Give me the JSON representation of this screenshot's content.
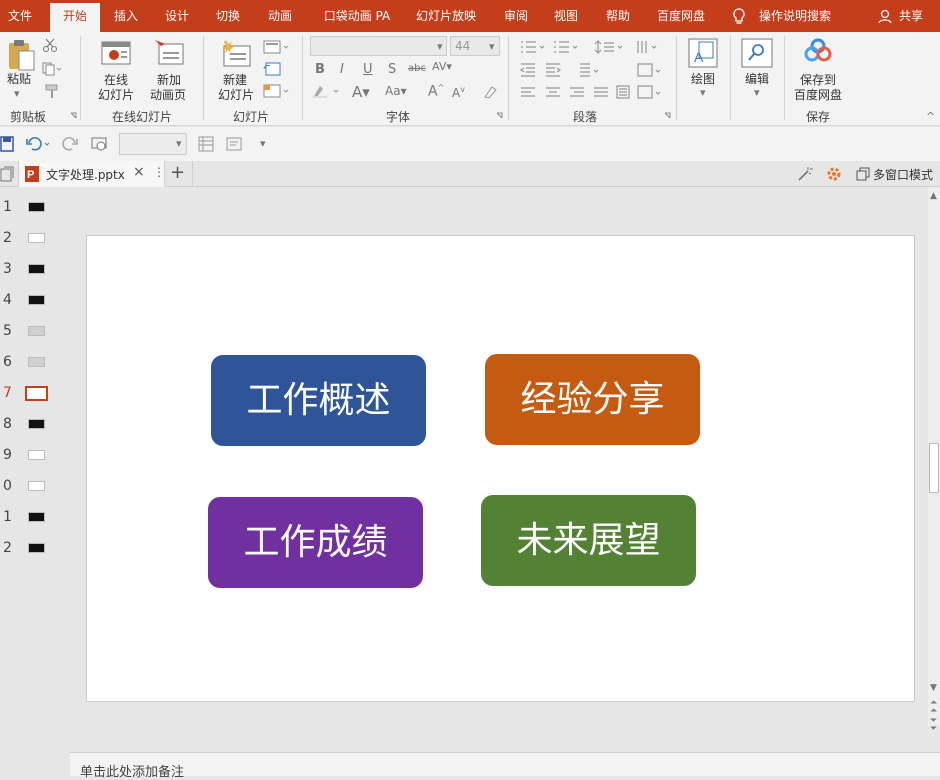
{
  "tabs": {
    "file": "文件",
    "home": "开始",
    "insert": "插入",
    "design": "设计",
    "transitions": "切换",
    "animations": "动画",
    "pocket": "口袋动画 PA",
    "slideshow": "幻灯片放映",
    "review": "审阅",
    "view": "视图",
    "help": "帮助",
    "baidu": "百度网盘",
    "tell_me": "操作说明搜索",
    "share": "共享"
  },
  "ribbon": {
    "paste_label": "粘贴",
    "clipboard_group": "剪贴板",
    "online_slides_label1": "在线",
    "online_slides_label2": "幻灯片",
    "new_anim_label1": "新加",
    "new_anim_label2": "动画页",
    "online_group": "在线幻灯片",
    "new_slide_label1": "新建",
    "new_slide_label2": "幻灯片",
    "slides_group": "幻灯片",
    "font_size": "44",
    "font_group": "字体",
    "paragraph_group": "段落",
    "draw_label": "绘图",
    "edit_label": "编辑",
    "save_baidu_label1": "保存到",
    "save_baidu_label2": "百度网盘",
    "save_group": "保存"
  },
  "document": {
    "tab_name": "文字处理.pptx",
    "multi_window": "多窗口模式"
  },
  "thumbnails": [
    {
      "num": "1",
      "color": "#111111"
    },
    {
      "num": "2",
      "color": "#ffffff"
    },
    {
      "num": "3",
      "color": "#111111"
    },
    {
      "num": "4",
      "color": "#111111"
    },
    {
      "num": "5",
      "color": "#d0d0d0"
    },
    {
      "num": "6",
      "color": "#d0d0d0"
    },
    {
      "num": "7",
      "color": "#ffffff"
    },
    {
      "num": "8",
      "color": "#111111"
    },
    {
      "num": "9",
      "color": "#ffffff"
    },
    {
      "num": "0",
      "color": "#ffffff"
    },
    {
      "num": "1",
      "color": "#111111"
    },
    {
      "num": "2",
      "color": "#111111"
    }
  ],
  "slide": {
    "card1": "工作概述",
    "card2": "经验分享",
    "card3": "工作成绩",
    "card4": "未来展望"
  },
  "notes_placeholder": "单击此处添加备注",
  "colors": {
    "brand": "#c43e1c",
    "card_blue": "#2e5597",
    "card_orange": "#c55a11",
    "card_purple": "#7030a0",
    "card_green": "#548235"
  }
}
